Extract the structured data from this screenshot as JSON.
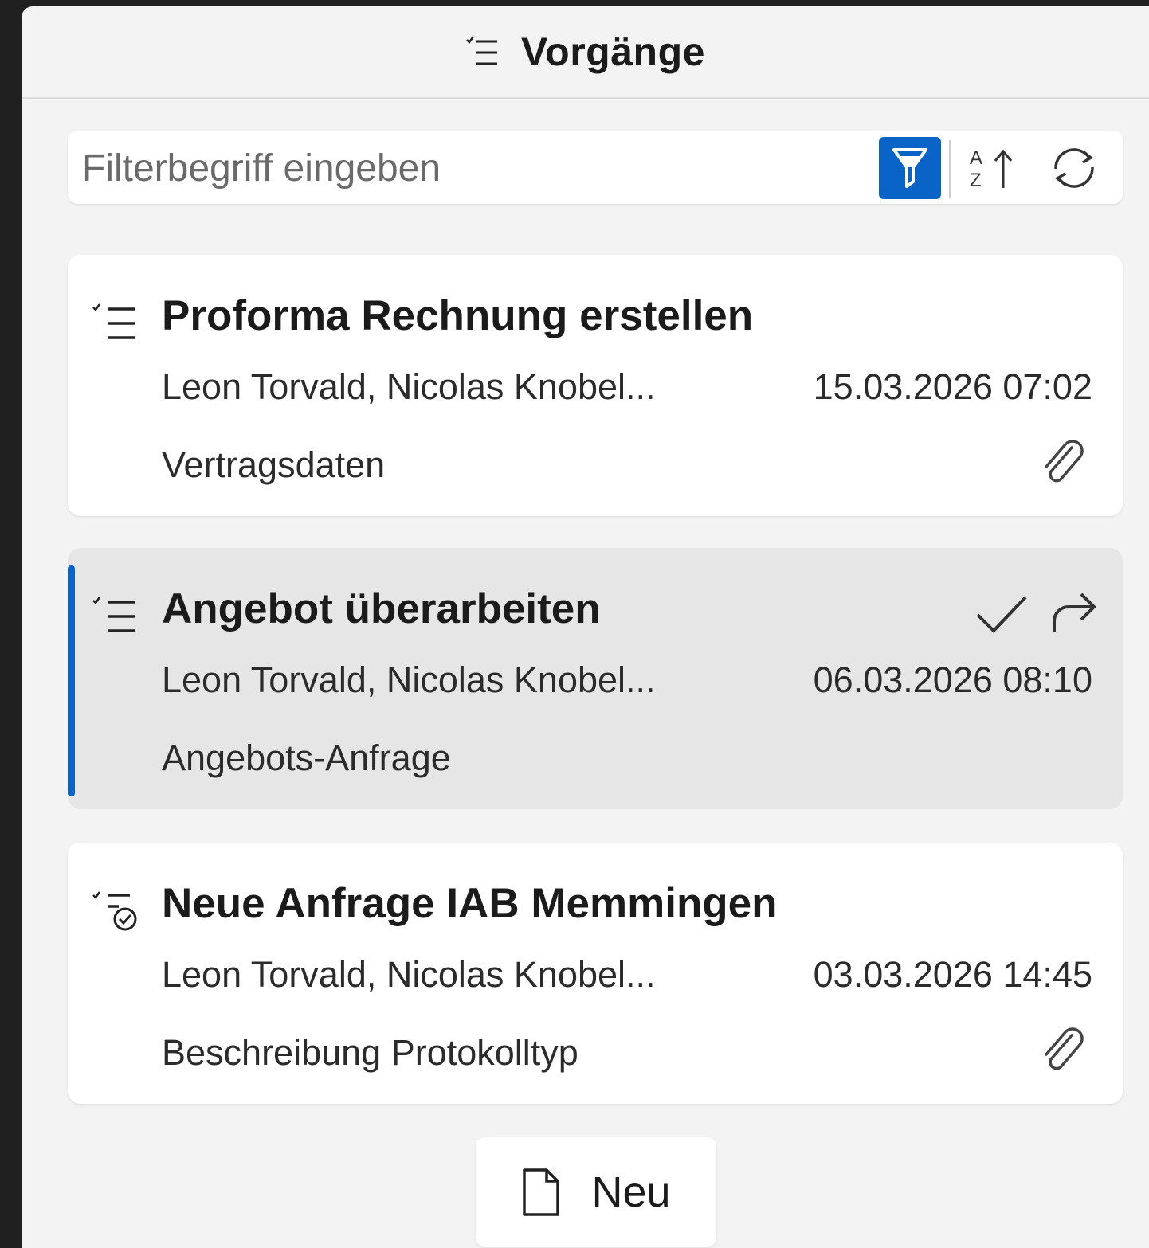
{
  "header": {
    "title": "Vorgänge",
    "icon": "task-list-icon"
  },
  "filter": {
    "placeholder": "Filterbegriff eingeben",
    "value": "",
    "filter_icon": "filter-icon",
    "sort_icon": "sort-az-icon",
    "refresh_icon": "refresh-icon",
    "accent_color": "#0a64c8"
  },
  "items": [
    {
      "title": "Proforma Rechnung erstellen",
      "people": "Leon Torvald, Nicolas Knobel...",
      "date": "15.03.2026 07:02",
      "type": "Vertragsdaten",
      "icon": "task-list-icon",
      "has_attachment": true,
      "selected": false
    },
    {
      "title": "Angebot überarbeiten",
      "people": "Leon Torvald, Nicolas Knobel...",
      "date": "06.03.2026 08:10",
      "type": "Angebots-Anfrage",
      "icon": "task-list-icon",
      "has_attachment": false,
      "selected": true,
      "actions": [
        "checkmark-icon",
        "forward-arrow-icon"
      ]
    },
    {
      "title": "Neue Anfrage IAB Memmingen",
      "people": "Leon Torvald, Nicolas Knobel...",
      "date": "03.03.2026 14:45",
      "type": "Beschreibung Protokolltyp",
      "icon": "task-list-done-icon",
      "has_attachment": true,
      "selected": false
    }
  ],
  "new_button": {
    "label": "Neu",
    "icon": "new-document-icon"
  }
}
